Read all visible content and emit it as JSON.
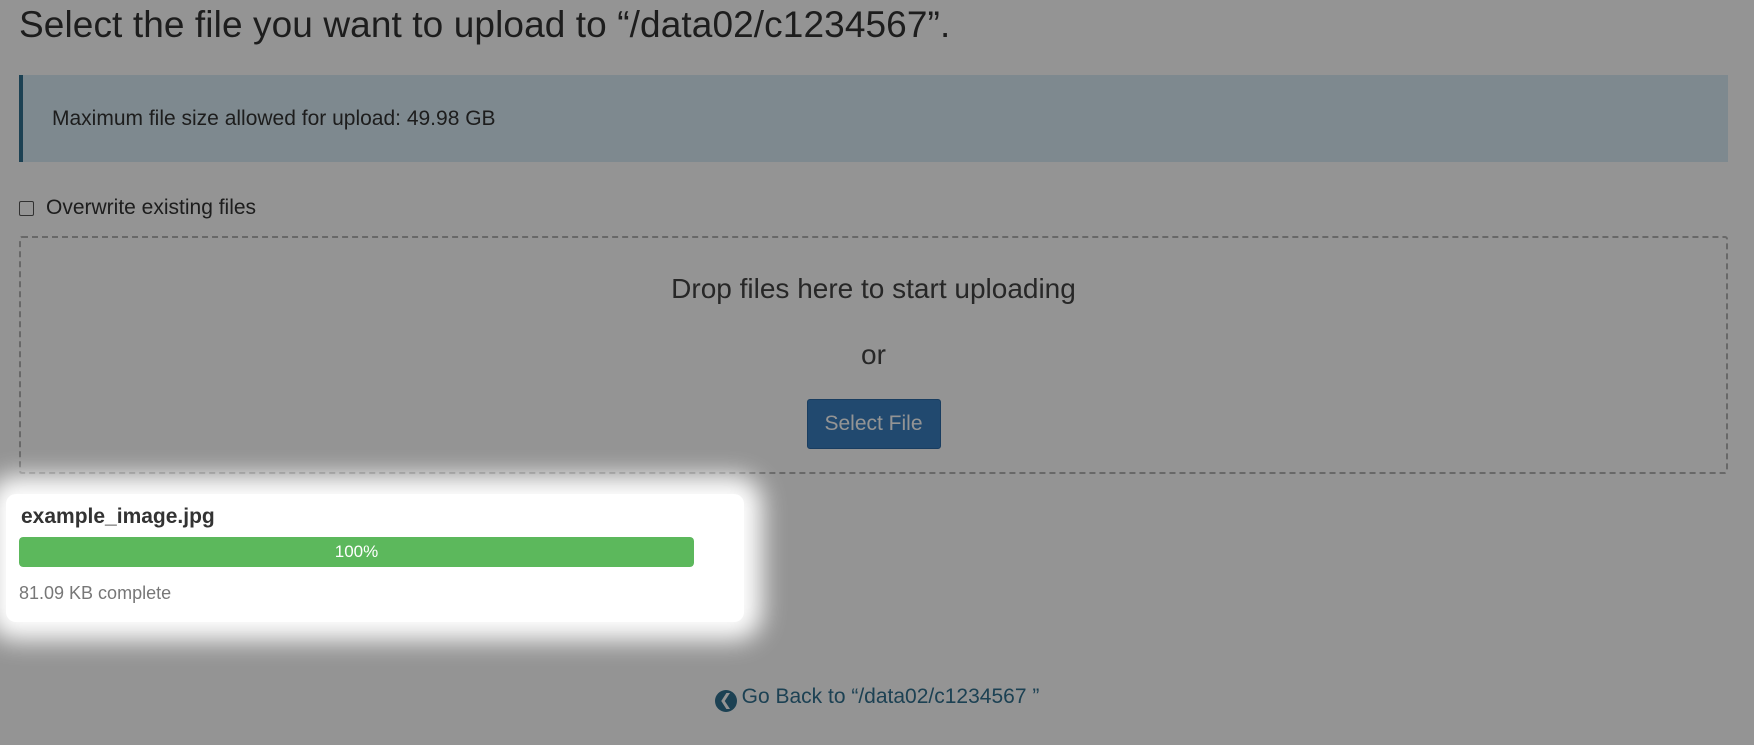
{
  "page": {
    "title": "Select the file you want to upload to “/data02/c1234567”."
  },
  "alert": {
    "max_size_text": "Maximum file size allowed for upload: 49.98 GB"
  },
  "overwrite": {
    "label": "Overwrite existing files",
    "checked": false
  },
  "dropzone": {
    "drop_text": "Drop files here to start uploading",
    "or_text": "or",
    "select_button_label": "Select File"
  },
  "upload": {
    "filename": "example_image.jpg",
    "progress_label": "100%",
    "progress_percent": 100,
    "status_text": "81.09 KB complete"
  },
  "back_link": {
    "label": "Go Back to “/data02/c1234567 ”",
    "icon": "arrow-circle-left-icon"
  },
  "colors": {
    "info_background": "#d9edf7",
    "info_border": "#31708f",
    "button_background": "#3a7fbf",
    "progress_fill": "#5cb85c",
    "link": "#31708f",
    "overlay": "rgba(0,0,0,0.42)"
  }
}
